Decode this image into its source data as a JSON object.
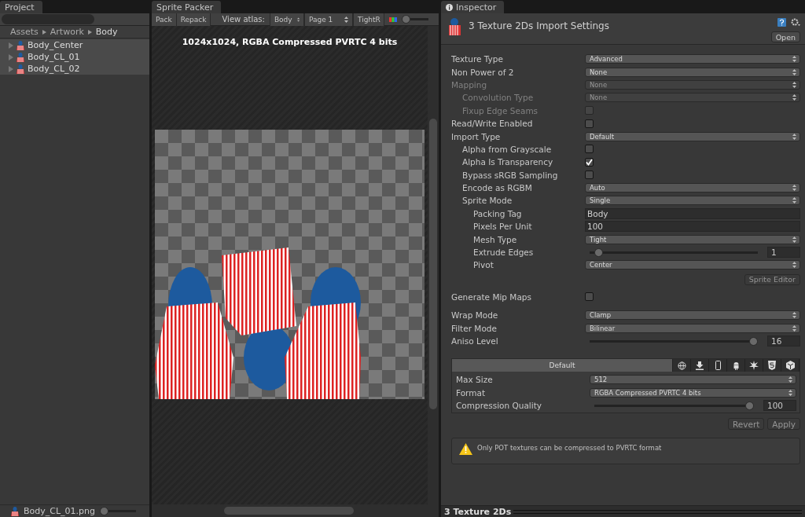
{
  "project_panel": {
    "tab": "Project",
    "breadcrumb": [
      "Assets",
      "Artwork",
      "Body"
    ],
    "items": [
      {
        "label": "Body_Center",
        "selected": true
      },
      {
        "label": "Body_CL_01",
        "selected": true
      },
      {
        "label": "Body_CL_02",
        "selected": true
      }
    ],
    "footer": {
      "file": "Body_CL_01.png",
      "level": 0
    }
  },
  "sprite_packer": {
    "tab": "Sprite Packer",
    "buttons": [
      "Pack",
      "Repack"
    ],
    "view_atlas_label": "View atlas:",
    "dropdowns": [
      "Body",
      "Page 1",
      "TightR"
    ],
    "zoom": {
      "level": 0
    },
    "atlas_info": "1024x1024, RGBA Compressed PVRTC 4 bits"
  },
  "inspector": {
    "tab": "Inspector",
    "title": "3 Texture 2Ds Import Settings",
    "open_button": "Open",
    "property_groups": [
      {
        "properties": [
          {
            "kind": "dropdown",
            "label": "Texture Type",
            "value": "Advanced",
            "disabled": false
          },
          {
            "kind": "dropdown",
            "label": "Non Power of 2",
            "value": "None",
            "disabled": false
          },
          {
            "kind": "dropdown",
            "label": "Mapping",
            "value": "None",
            "disabled": true,
            "children": [
              {
                "kind": "dropdown",
                "label": "Convolution Type",
                "value": "None",
                "disabled": true
              },
              {
                "kind": "checkbox",
                "label": "Fixup Edge Seams",
                "checked": false,
                "disabled": true
              }
            ]
          },
          {
            "kind": "checkbox",
            "label": "Read/Write Enabled",
            "checked": false,
            "disabled": false
          },
          {
            "kind": "dropdown",
            "label": "Import Type",
            "value": "Default",
            "disabled": false,
            "children": [
              {
                "kind": "checkbox",
                "label": "Alpha from Grayscale",
                "checked": false,
                "disabled": false
              },
              {
                "kind": "checkbox",
                "label": "Alpha Is Transparency",
                "checked": true,
                "disabled": false
              },
              {
                "kind": "checkbox",
                "label": "Bypass sRGB Sampling",
                "checked": false,
                "disabled": false
              },
              {
                "kind": "dropdown",
                "label": "Encode as RGBM",
                "value": "Auto",
                "disabled": false
              },
              {
                "kind": "dropdown",
                "label": "Sprite Mode",
                "value": "Single",
                "disabled": false,
                "children": [
                  {
                    "kind": "text",
                    "label": "Packing Tag",
                    "value": "Body",
                    "disabled": false
                  },
                  {
                    "kind": "text",
                    "label": "Pixels Per Unit",
                    "value": "100",
                    "disabled": false
                  },
                  {
                    "kind": "dropdown",
                    "label": "Mesh Type",
                    "value": "Tight",
                    "disabled": false
                  },
                  {
                    "kind": "slider",
                    "label": "Extrude Edges",
                    "value": "1",
                    "level": 0.03,
                    "disabled": false
                  },
                  {
                    "kind": "dropdown",
                    "label": "Pivot",
                    "value": "Center",
                    "disabled": false
                  }
                ]
              }
            ]
          }
        ],
        "button": {
          "label": "Sprite Editor",
          "disabled": true
        }
      },
      {
        "properties": [
          {
            "kind": "checkbox",
            "label": "Generate Mip Maps",
            "checked": false,
            "disabled": false
          }
        ]
      },
      {
        "properties": [
          {
            "kind": "dropdown",
            "label": "Wrap Mode",
            "value": "Clamp",
            "disabled": false
          },
          {
            "kind": "dropdown",
            "label": "Filter Mode",
            "value": "Bilinear",
            "disabled": false
          },
          {
            "kind": "slider",
            "label": "Aniso Level",
            "value": "16",
            "level": 1,
            "disabled": false
          }
        ]
      }
    ],
    "platform_tabs": [
      {
        "kind": "label",
        "label": "Default",
        "selected": true
      },
      {
        "kind": "globe",
        "selected": false
      },
      {
        "kind": "download",
        "selected": false
      },
      {
        "kind": "phone",
        "selected": false
      },
      {
        "kind": "android",
        "selected": false
      },
      {
        "kind": "burst",
        "selected": false
      },
      {
        "kind": "html5",
        "selected": false
      },
      {
        "kind": "cube",
        "selected": false
      }
    ],
    "platform_properties": [
      {
        "kind": "dropdown",
        "label": "Max Size",
        "value": "512",
        "disabled": false
      },
      {
        "kind": "dropdown",
        "label": "Format",
        "value": "RGBA Compressed PVRTC 4 bits",
        "disabled": false
      },
      {
        "kind": "slider",
        "label": "Compression Quality",
        "value": "100",
        "level": 1,
        "disabled": false
      }
    ],
    "buttons": [
      {
        "label": "Revert",
        "disabled": true
      },
      {
        "label": "Apply",
        "disabled": true
      }
    ],
    "warning": "Only POT textures can be compressed to PVRTC format"
  },
  "status_bar": "3 Texture 2Ds"
}
